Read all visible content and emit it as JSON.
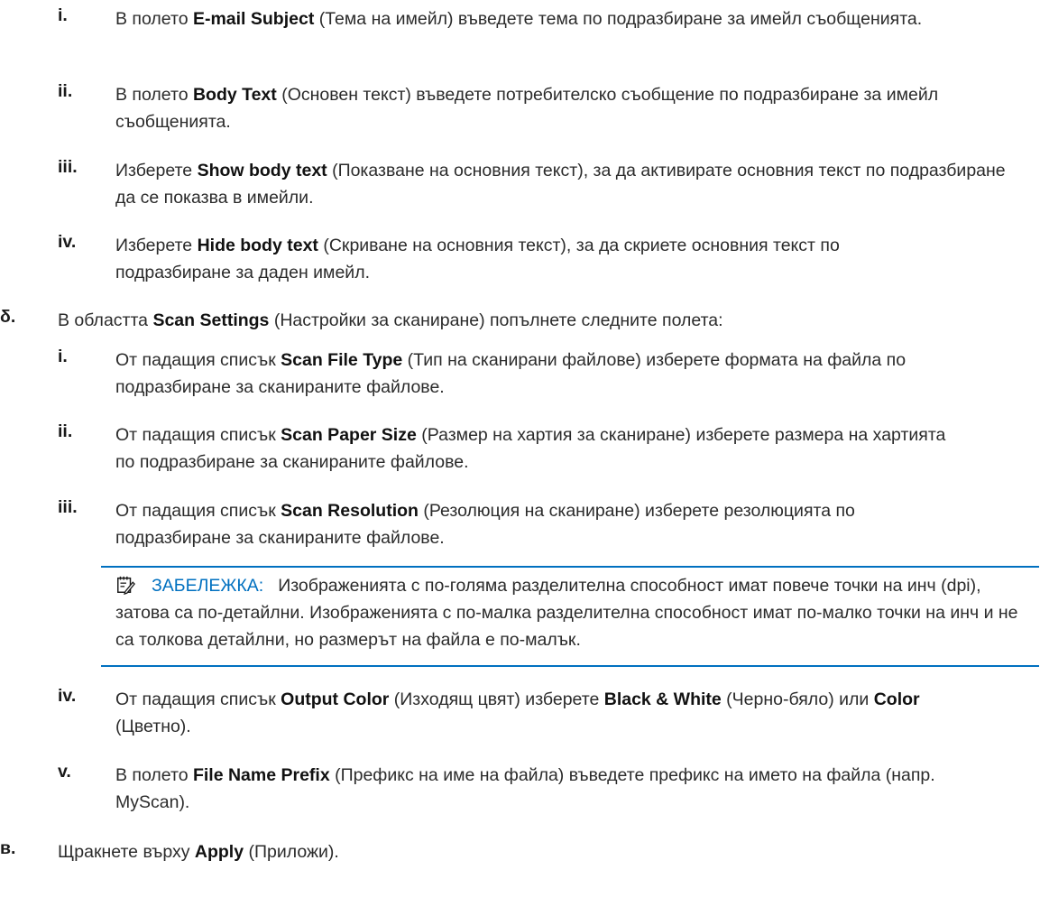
{
  "items": [
    {
      "marker": "i.",
      "pre": "В полето ",
      "bold": "E-mail Subject",
      "post": " (Тема на имейл) въведете тема по подразбиране за имейл съобщенията."
    },
    {
      "marker": "ii.",
      "pre": "В полето ",
      "bold": "Body Text",
      "post": " (Основен текст) въведете потребителско съобщение по подразбиране за имейл съобщенията."
    },
    {
      "marker": "iii.",
      "pre": "Изберете ",
      "bold": "Show body text",
      "post": " (Показване на основния текст), за да активирате основния текст по подразбиране да се показва в имейли."
    },
    {
      "marker": "iv.",
      "pre": "Изберете ",
      "bold": "Hide body text",
      "post": " (Скриване на основния текст), за да скриете основния текст по подразбиране за даден имейл."
    },
    {
      "marker": "δ.",
      "pre": "В областта ",
      "bold": "Scan Settings",
      "post": " (Настройки за сканиране) попълнете следните полета:"
    },
    {
      "marker": "i.",
      "pre": "От падащия списък ",
      "bold": "Scan File Type",
      "post": " (Тип на сканирани файлове) изберете формата на файла по подразбиране за сканираните файлове."
    },
    {
      "marker": "ii.",
      "pre": "От падащия списък ",
      "bold": "Scan Paper Size",
      "post": " (Размер на хартия за сканиране) изберете размера на хартията по подразбиране за сканираните файлове."
    },
    {
      "marker": "iii.",
      "pre": "От падащия списък ",
      "bold": "Scan Resolution",
      "post": " (Резолюция на сканиране) изберете резолюцията по подразбиране за сканираните файлове."
    },
    {
      "marker": "iv.",
      "pre": "От падащия списък ",
      "bold": "Output Color",
      "post": " (Изходящ цвят) изберете ",
      "bold2": "Black & White",
      "post2": " (Черно-бяло) или ",
      "bold3": "Color",
      "post3": " (Цветно)."
    },
    {
      "marker": "v.",
      "pre": "В полето ",
      "bold": "File Name Prefix",
      "post": " (Префикс на име на файла) въведете префикс на името на файла (напр. MyScan)."
    },
    {
      "marker": "в.",
      "pre": "Щракнете върху ",
      "bold": "Apply",
      "post": " (Приложи)."
    }
  ],
  "note": {
    "label": "ЗАБЕЛЕЖКА:",
    "text": "Изображенията с по-голяма разделителна способност имат повече точки на инч (dpi), затова са по-детайлни. Изображенията с по-малка разделителна способност имат по-малко точки на инч и не са толкова детайлни, но размерът на файла е по-малък.",
    "icon": "note-icon",
    "accent": "#0070c0"
  }
}
